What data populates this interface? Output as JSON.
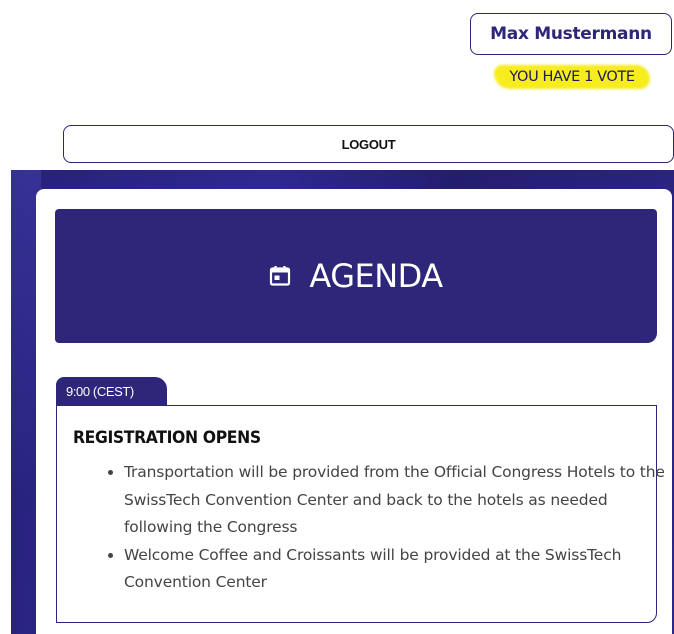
{
  "user": {
    "name": "Max Mustermann",
    "votes_label": "YOU HAVE 1 VOTE"
  },
  "toolbar": {
    "logout_label": "LOGOUT"
  },
  "agenda": {
    "title": "AGENDA",
    "icon": "calendar-icon",
    "sessions": [
      {
        "time": "9:00 (CEST)",
        "title": "REGISTRATION OPENS",
        "items": [
          "Transportation will be provided from the Official Congress Hotels to the SwissTech Convention Center and back to the hotels as needed following the Congress",
          "Welcome Coffee and Croissants will be provided at the SwissTech Convention Center"
        ]
      }
    ]
  },
  "colors": {
    "brand": "#2d2679",
    "highlight": "#f7ec1d"
  }
}
